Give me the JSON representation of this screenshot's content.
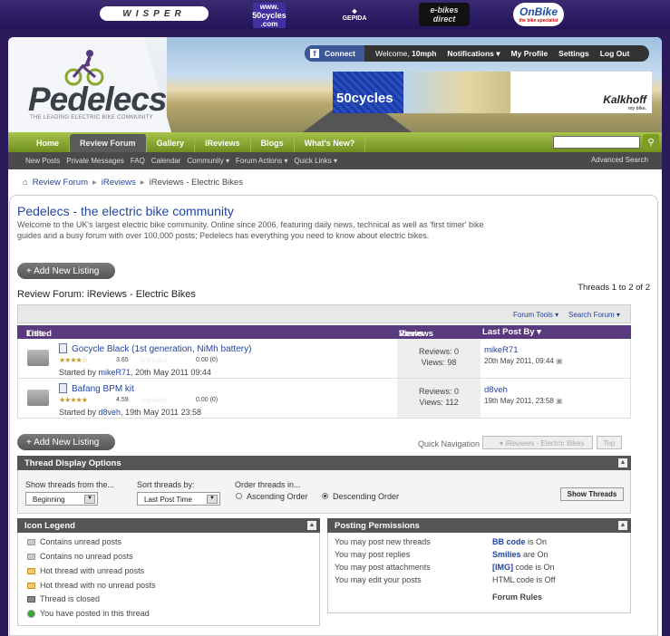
{
  "sponsors": {
    "wisper": "WISPER",
    "fifty": "50cycles",
    "fifty_small": "www.",
    "fifty_com": ".com",
    "gepida": "GEPIDA",
    "ebikes1": "e-bikes",
    "ebikes2": "direct",
    "onbike": "OnBike",
    "onbike_small": "the bike specialist"
  },
  "header": {
    "logo": "Pedelecs",
    "tagline": "THE LEADING ELECTRIC BIKE COMMUNITY",
    "connect": "Connect",
    "welcome": "Welcome, ",
    "username": "10mph",
    "notifications": "Notifications",
    "my_profile": "My Profile",
    "settings": "Settings",
    "logout": "Log Out",
    "banner_text": "50cycles",
    "banner_brand": "Kalkhoff",
    "banner_brand_sub": "my bike."
  },
  "nav": {
    "tabs": [
      "Home",
      "Review Forum",
      "Gallery",
      "iReviews",
      "Blogs",
      "What's New?"
    ],
    "active": "Review Forum"
  },
  "subnav": {
    "items": [
      "New Posts",
      "Private Messages",
      "FAQ",
      "Calendar",
      "Community ▾",
      "Forum Actions ▾",
      "Quick Links ▾"
    ],
    "advanced": "Advanced Search"
  },
  "breadcrumb": {
    "home": "Review Forum",
    "sep": "▸",
    "ireviews": "iReviews",
    "current": "iReviews - Electric Bikes"
  },
  "intro": {
    "title": "Pedelecs - the electric bike community",
    "description": "Welcome to the UK's largest electric bike community. Online since 2006, featuring daily news, technical as well as 'first timer' bike guides and a busy forum with over 100,000 posts; Pedelecs has everything you need to know about electric bikes."
  },
  "add_listing": "+ Add New Listing",
  "threads_count": "Threads 1 to 2 of 2",
  "forum_title": "Review Forum: iReviews - Electric Bikes",
  "tools": {
    "forum_tools": "Forum Tools ▾",
    "search_forum": "Search Forum ▾"
  },
  "thead": {
    "title": "Title",
    "slash": " / ",
    "listed_by": "Listed by",
    "reviews": "Reviews",
    "views": "Views",
    "last_post": "Last Post By ▾"
  },
  "threads": [
    {
      "title": "Gocycle Black (1st generation, NiMh battery)",
      "stars": "★★★★☆",
      "rating": "3.65",
      "stars2": "☆☆☆☆☆",
      "rating2": "0.00 (0)",
      "started_pre": "Started by ",
      "starter": "mikeR71",
      "started_post": ", 20th May 2011 09:44",
      "reviews": "Reviews: 0",
      "views": "Views: 98",
      "last_by": "mikeR71",
      "last_date": "20th May 2011, 09:44"
    },
    {
      "title": "Bafang BPM kit",
      "stars": "★★★★★",
      "rating": "4.59",
      "stars2": "☆☆☆☆☆",
      "rating2": "0.00 (0)",
      "started_pre": "Started by ",
      "starter": "d8veh",
      "started_post": ", 19th May 2011 23:58",
      "reviews": "Reviews: 0",
      "views": "Views: 112",
      "last_by": "d8veh",
      "last_date": "19th May 2011, 23:58"
    }
  ],
  "quick_nav": {
    "label": "Quick Navigation",
    "select": "iReviews - Electric Bikes",
    "top": "Top"
  },
  "display_options": {
    "title": "Thread Display Options",
    "show_from_label": "Show threads from the...",
    "show_from_value": "Beginning",
    "sort_label": "Sort threads by:",
    "sort_value": "Last Post Time",
    "order_label": "Order threads in...",
    "ascending": "Ascending Order",
    "descending": "Descending Order",
    "show_button": "Show Threads"
  },
  "legend": {
    "title": "Icon Legend",
    "items": [
      "Contains unread posts",
      "Contains no unread posts",
      "Hot thread with unread posts",
      "Hot thread with no unread posts",
      "Thread is closed",
      "You have posted in this thread"
    ]
  },
  "permissions": {
    "title": "Posting Permissions",
    "rows": [
      "You may post new threads",
      "You may post replies",
      "You may post attachments",
      "You may edit your posts"
    ],
    "bb": "BB code",
    "bb_state": " is On",
    "smilies": "Smilies",
    "smilies_state": " are On",
    "img": "[IMG]",
    "img_state": " code is On",
    "html": "HTML code is Off",
    "rules": "Forum Rules"
  }
}
